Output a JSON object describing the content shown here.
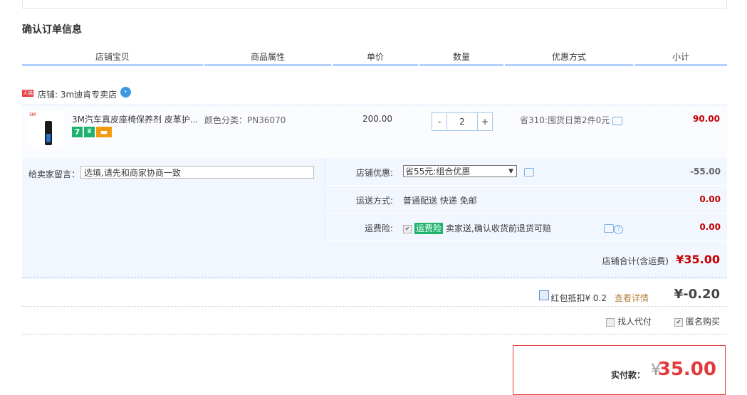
{
  "section_title": "确认订单信息",
  "columns": [
    "店铺宝贝",
    "商品属性",
    "单价",
    "数量",
    "优惠方式",
    "小计"
  ],
  "shop": {
    "tmall_icon": "天猫",
    "label": "店铺: 3m迪肯专卖店",
    "ww_icon": "chat-bubble"
  },
  "item": {
    "thumb_brand": "3M",
    "title": "3M汽车真皮座椅保养剂 皮革护...",
    "badges": [
      "7",
      "Q",
      "card"
    ],
    "prop": "颜色分类：PN36070",
    "price": "200.00",
    "qty_minus": "-",
    "qty": "2",
    "qty_plus": "+",
    "promo": "省310:囤货日第2件0元",
    "subtotal": "90.00"
  },
  "memo": {
    "label": "给卖家留言：",
    "placeholder": "选填,请先和商家协商一致"
  },
  "options": {
    "shop_discount": {
      "label": "店铺优惠:",
      "selected": "省55元:组合优惠",
      "amount": "-55.00"
    },
    "shipping": {
      "label": "运送方式:",
      "value": "普通配送 快递 免邮",
      "amount": "0.00"
    },
    "insurance": {
      "label": "运费险:",
      "tag": "运费险",
      "value": "卖家送,确认收货前退货可赔",
      "amount": "0.00"
    }
  },
  "shop_total": {
    "label": "店铺合计(含运费)",
    "amount": "¥35.00"
  },
  "hongbao": {
    "text": "红包抵扣¥ 0.2",
    "link": "查看详情",
    "amount": "¥-0.20"
  },
  "extra_options": {
    "daifu": "找人代付",
    "anon": "匿名购买"
  },
  "pay": {
    "label": "实付款：",
    "yen": "¥",
    "amount": "35.00"
  },
  "colors": {
    "accent": "#c40000",
    "border_blue": "#b2d1ff",
    "pay_red": "#e4393c"
  }
}
